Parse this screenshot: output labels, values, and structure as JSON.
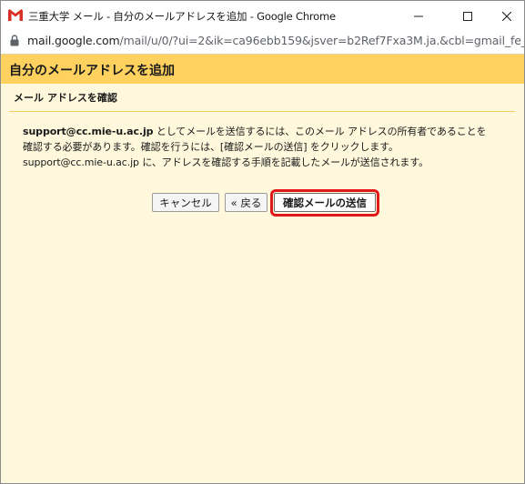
{
  "window": {
    "title": "三重大学 メール - 自分のメールアドレスを追加 - Google Chrome"
  },
  "address_bar": {
    "host": "mail.google.com",
    "path": "/mail/u/0/?ui=2&ik=ca96ebb159&jsver=b2Ref7Fxa3M.ja.&cbl=gmail_fe_2..."
  },
  "dialog": {
    "title": "自分のメールアドレスを追加",
    "section_title": "メール アドレスを確認",
    "body": {
      "line1_email": "support@cc.mie-u.ac.jp",
      "line1_rest": " としてメールを送信するには、このメール アドレスの所有者であることを",
      "line2": "確認する必要があります。確認を行うには、[確認メールの送信] をクリックします。",
      "line3": "support@cc.mie-u.ac.jp に、アドレスを確認する手順を記載したメールが送信されます。"
    },
    "buttons": {
      "cancel": "キャンセル",
      "back": "« 戻る",
      "send": "確認メールの送信"
    }
  },
  "colors": {
    "header": "#ffd260",
    "page_background": "#fff8dc",
    "highlight": "#e01818"
  },
  "icons": [
    "gmail-icon",
    "minimize-icon",
    "maximize-icon",
    "close-icon",
    "lock-icon"
  ]
}
